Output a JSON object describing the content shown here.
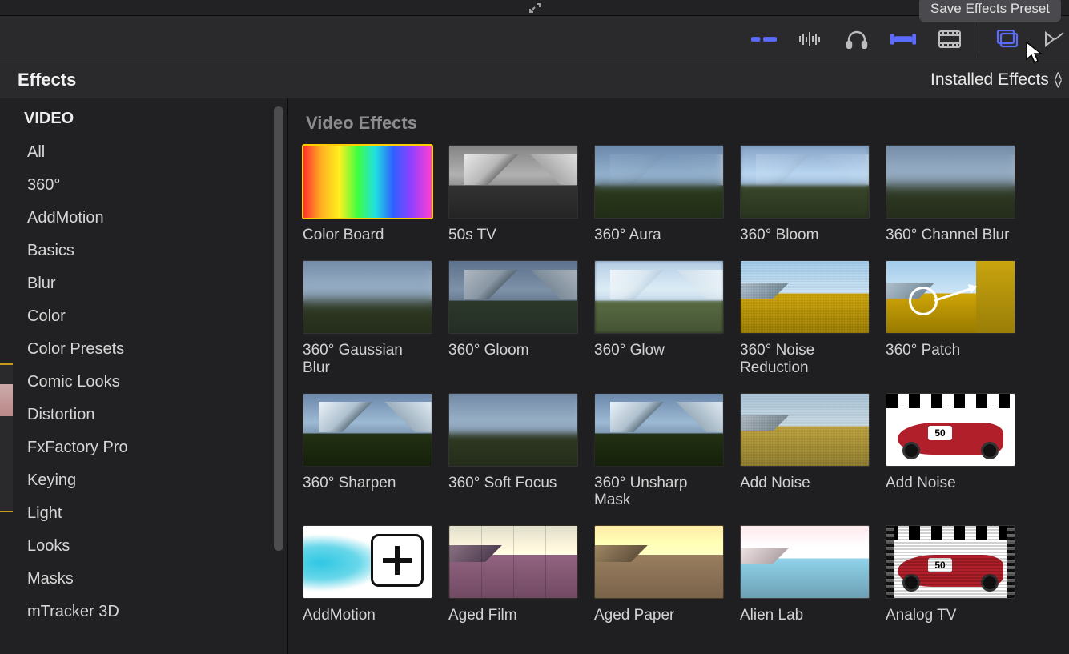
{
  "topbar": {
    "save_preset_label": "Save Effects Preset"
  },
  "toolbar_icons": [
    {
      "name": "fade-handles-icon",
      "accent": true
    },
    {
      "name": "audio-waveform-icon",
      "accent": false
    },
    {
      "name": "headphones-icon",
      "accent": false
    },
    {
      "name": "range-markers-icon",
      "accent": true
    },
    {
      "name": "filmstrip-icon",
      "accent": false
    },
    {
      "name": "media-browser-icon",
      "accent": true
    },
    {
      "name": "bowtie-icon",
      "accent": false
    }
  ],
  "browser": {
    "title": "Effects",
    "dropdown_label": "Installed Effects"
  },
  "sidebar": {
    "header": "VIDEO",
    "categories": [
      "All",
      "360°",
      "AddMotion",
      "Basics",
      "Blur",
      "Color",
      "Color Presets",
      "Comic Looks",
      "Distortion",
      "FxFactory Pro",
      "Keying",
      "Light",
      "Looks",
      "Masks",
      "mTracker 3D"
    ]
  },
  "grid": {
    "heading": "Video Effects",
    "effects": [
      {
        "label": "Color Board",
        "thumb": "colorboard",
        "selected": true
      },
      {
        "label": "50s TV",
        "thumb": "mountain bw"
      },
      {
        "label": "360° Aura",
        "thumb": "mountain aura"
      },
      {
        "label": "360° Bloom",
        "thumb": "mountain bloom"
      },
      {
        "label": "360° Channel Blur",
        "thumb": "mountain blurred"
      },
      {
        "label": "360° Gaussian Blur",
        "thumb": "mountain blurred"
      },
      {
        "label": "360° Gloom",
        "thumb": "mountain gloom"
      },
      {
        "label": "360° Glow",
        "thumb": "mountain glow"
      },
      {
        "label": "360° Noise Reduction",
        "thumb": "fieldscene noisy yellowish"
      },
      {
        "label": "360° Patch",
        "thumb": "fieldscene yellowish",
        "overlay": "patch"
      },
      {
        "label": "360° Sharpen",
        "thumb": "mountain sharpen"
      },
      {
        "label": "360° Soft Focus",
        "thumb": "mountain softblur"
      },
      {
        "label": "360° Unsharp Mask",
        "thumb": "mountain sharpen"
      },
      {
        "label": "Add Noise",
        "thumb": "fieldscene noisy"
      },
      {
        "label": "Add Noise",
        "thumb": "racecar",
        "car_num": "50"
      },
      {
        "label": "AddMotion",
        "thumb": "addmotion"
      },
      {
        "label": "Aged Film",
        "thumb": "autumn filmish"
      },
      {
        "label": "Aged Paper",
        "thumb": "autumn paperish"
      },
      {
        "label": "Alien Lab",
        "thumb": "fieldscene alienlab"
      },
      {
        "label": "Analog TV",
        "thumb": "racecar analogtv",
        "car_num": "50"
      }
    ]
  }
}
